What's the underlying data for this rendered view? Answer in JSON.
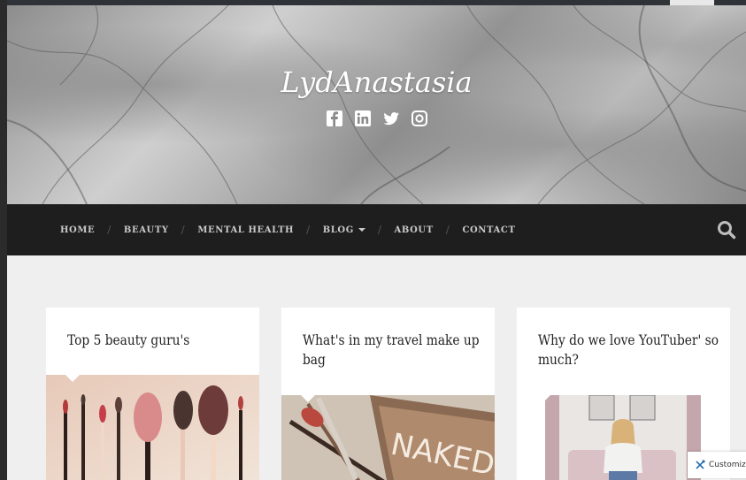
{
  "site": {
    "title": "LydAnastasia",
    "social": [
      {
        "icon": "facebook-icon"
      },
      {
        "icon": "linkedin-icon"
      },
      {
        "icon": "twitter-icon"
      },
      {
        "icon": "instagram-icon"
      }
    ]
  },
  "nav": {
    "items": [
      {
        "label": "HOME"
      },
      {
        "label": "BEAUTY"
      },
      {
        "label": "MENTAL HEALTH"
      },
      {
        "label": "BLOG"
      },
      {
        "label": "ABOUT"
      },
      {
        "label": "CONTACT"
      }
    ],
    "search_icon": "search-icon"
  },
  "posts": [
    {
      "title": "Top 5 beauty guru's"
    },
    {
      "title": "What's in my travel make up bag"
    },
    {
      "title": "Why do we love YouTuber' so much?"
    }
  ],
  "customize": {
    "label": "Customize"
  },
  "colors": {
    "nav_bg": "#1e1e1e",
    "nav_text": "#c9c9c9",
    "page_bg": "#efefef",
    "card_bg": "#ffffff"
  }
}
